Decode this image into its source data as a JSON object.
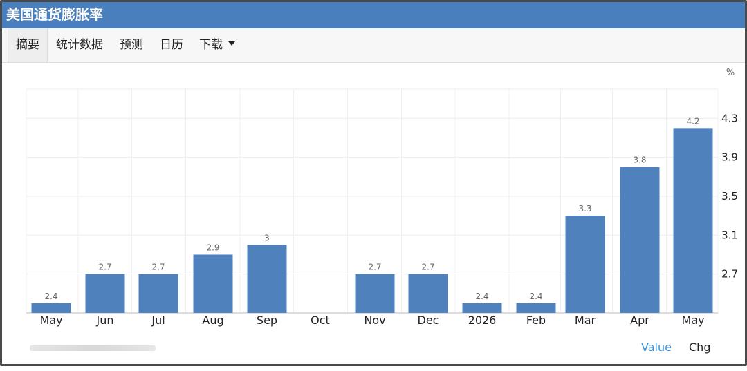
{
  "header": {
    "title": "美国通货膨胀率"
  },
  "tabs": [
    {
      "label": "摘要"
    },
    {
      "label": "统计数据"
    },
    {
      "label": "预测"
    },
    {
      "label": "日历"
    },
    {
      "label": "下载"
    }
  ],
  "footer": {
    "value_label": "Value",
    "chg_label": "Chg"
  },
  "colors": {
    "header_bg": "#4a7fbd",
    "bar": "#4f81bd",
    "link": "#3a8fd6"
  },
  "chart_data": {
    "type": "bar",
    "unit": "%",
    "categories": [
      "May",
      "Jun",
      "Jul",
      "Aug",
      "Sep",
      "Oct",
      "Nov",
      "Dec",
      "2026",
      "Feb",
      "Mar",
      "Apr",
      "May"
    ],
    "values": [
      2.4,
      2.7,
      2.7,
      2.9,
      3,
      null,
      2.7,
      2.7,
      2.4,
      2.4,
      3.3,
      3.8,
      4.2
    ],
    "data_labels": [
      "2.4",
      "2.7",
      "2.7",
      "2.9",
      "3",
      "",
      "2.7",
      "2.7",
      "2.4",
      "2.4",
      "3.3",
      "3.8",
      "4.2"
    ],
    "yticks": [
      "2.7",
      "3.1",
      "3.5",
      "3.9",
      "4.3"
    ],
    "ylim": [
      2.3,
      4.6
    ],
    "y_axis_position": "right",
    "grid": true
  }
}
